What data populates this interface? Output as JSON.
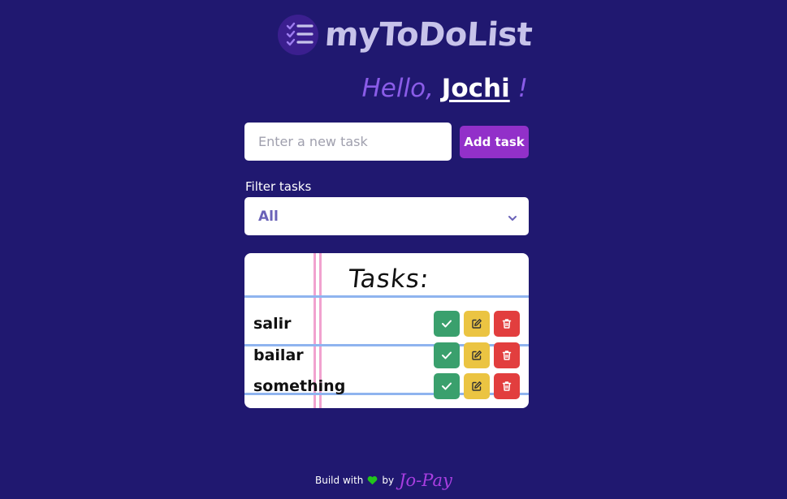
{
  "app": {
    "logo_text": "myToDoList",
    "logo_icon": "checklist-icon"
  },
  "greeting": {
    "prefix": "Hello,",
    "user": "Jochi",
    "suffix": "!"
  },
  "new_task": {
    "placeholder": "Enter a new task",
    "value": "",
    "add_label": "Add task"
  },
  "filter": {
    "label": "Filter tasks",
    "selected": "All"
  },
  "tasks": {
    "title": "Tasks:",
    "items": [
      {
        "name": "salir"
      },
      {
        "name": "bailar"
      },
      {
        "name": "something"
      }
    ],
    "action_icons": [
      "check-icon",
      "edit-icon",
      "trash-icon"
    ]
  },
  "footer": {
    "text_before": "Build with",
    "text_after": "by",
    "brand": "Jo-Pay",
    "heart_icon": "heart-icon"
  },
  "colors": {
    "background": "#201870",
    "accent": "#9230c9",
    "greeting": "#8a5ce8",
    "done": "#3aa06d",
    "edit": "#ebc442",
    "delete": "#e23e3e",
    "heart": "#22c41c"
  }
}
